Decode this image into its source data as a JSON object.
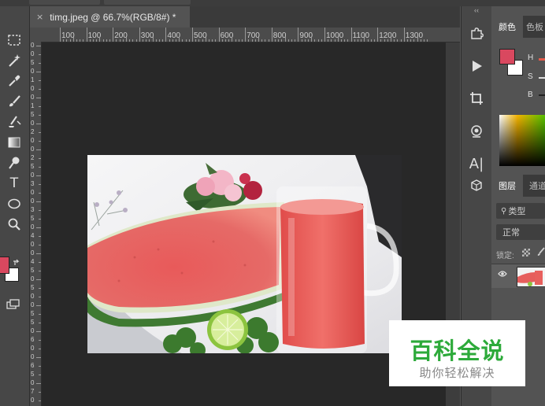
{
  "document": {
    "tab_title": "timg.jpeg @ 66.7%(RGB/8#) *",
    "close_glyph": "×"
  },
  "rulers": {
    "horizontal_labels": [
      "100",
      "100",
      "200",
      "300",
      "400",
      "500",
      "600",
      "700",
      "800",
      "900",
      "1000",
      "1100",
      "1200",
      "1300"
    ],
    "vertical_labels": [
      "0",
      "0",
      "5",
      "0",
      "1",
      "0",
      "0",
      "1",
      "5",
      "0",
      "2",
      "0",
      "0",
      "2",
      "5",
      "0",
      "3",
      "0",
      "0",
      "3",
      "5",
      "0",
      "4",
      "0",
      "0",
      "4",
      "5",
      "0",
      "5",
      "0",
      "0",
      "5",
      "5",
      "0",
      "6",
      "0",
      "0",
      "6",
      "5",
      "0",
      "7",
      "0"
    ]
  },
  "toolbar": {
    "tools": [
      {
        "name": "marquee-tool-icon"
      },
      {
        "name": "magic-wand-tool-icon"
      },
      {
        "name": "eyedropper-tool-icon"
      },
      {
        "name": "brush-tool-icon"
      },
      {
        "name": "clone-stamp-tool-icon"
      },
      {
        "name": "gradient-tool-icon"
      },
      {
        "name": "dodge-tool-icon"
      },
      {
        "name": "type-tool-icon",
        "glyph": "T"
      },
      {
        "name": "ellipse-tool-icon"
      },
      {
        "name": "zoom-tool-icon"
      }
    ],
    "foreground_color": "#d9485f",
    "background_color": "#ffffff"
  },
  "mid_column": {
    "collapse_glyph": "‹‹",
    "icons": [
      {
        "name": "puzzle-plugin-icon"
      },
      {
        "name": "play-action-icon"
      },
      {
        "name": "crop-icon"
      },
      {
        "name": "device-preview-icon"
      },
      {
        "name": "character-panel-icon",
        "glyph": "A|"
      },
      {
        "name": "3d-cube-icon"
      }
    ]
  },
  "color_panel": {
    "tabs": [
      "颜色",
      "色板"
    ],
    "swatch_color": "#d9485f",
    "sliders": [
      "H",
      "S",
      "B"
    ]
  },
  "layers_panel": {
    "tabs": [
      "图层",
      "通道"
    ],
    "search_placeholder": "类型",
    "blend_mode": "正常",
    "lock_label": "锁定:",
    "layer_visibility_glyph": "👁"
  },
  "watermark": {
    "title": "百科全说",
    "subtitle": "助你轻松解决"
  },
  "colors": {
    "canvas_background": "#282828",
    "panel_background": "#535353",
    "toolbar_background": "#474747",
    "watermark_green": "#2daa3a"
  }
}
